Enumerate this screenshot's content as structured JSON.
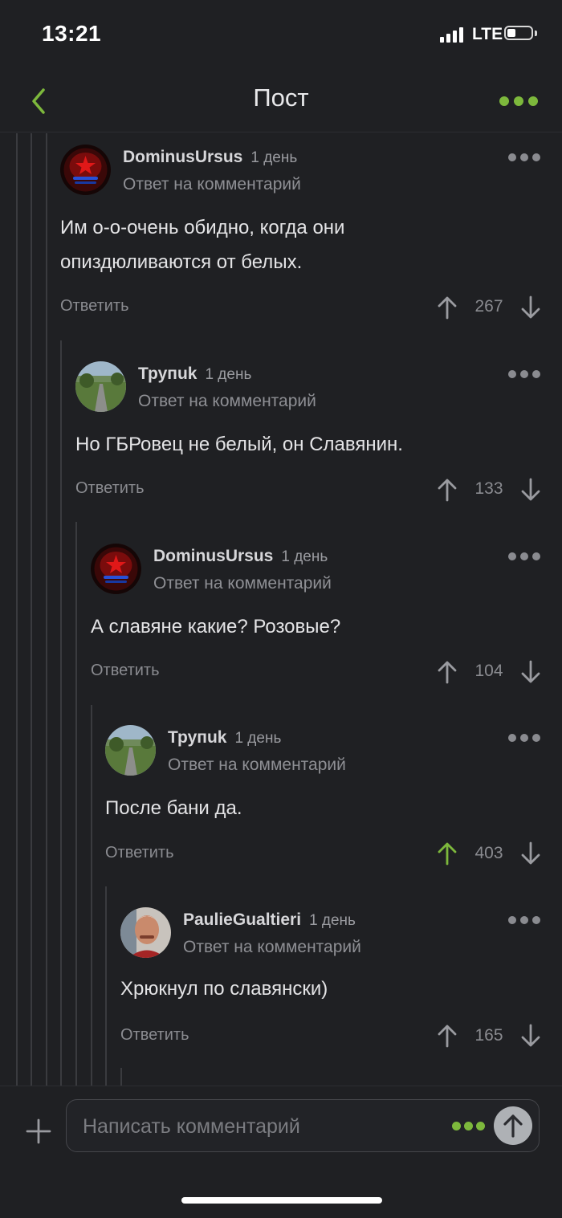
{
  "status_bar": {
    "time": "13:21",
    "network": "LTE"
  },
  "nav": {
    "title": "Пост",
    "back_icon": "chevron-left-icon",
    "more_icon": "more-dots-icon"
  },
  "colors": {
    "accent": "#7db83c",
    "background": "#1f2023",
    "muted": "#8a8b90"
  },
  "comments": [
    {
      "author": "DominusUrsus",
      "time": "1 день",
      "subtitle": "Ответ на комментарий",
      "text_lines": [
        "Им о-о-очень обидно, когда они",
        "опиздюливаются от белых."
      ],
      "reply_label": "Ответить",
      "score": "267",
      "upvoted": false,
      "avatar": "red-mask-avatar"
    },
    {
      "author": "Трупuk",
      "time": "1 день",
      "subtitle": "Ответ на комментарий",
      "text_lines": [
        "Но ГБРовец не белый, он Славянин."
      ],
      "reply_label": "Ответить",
      "score": "133",
      "upvoted": false,
      "avatar": "road-landscape-avatar"
    },
    {
      "author": "DominusUrsus",
      "time": "1 день",
      "subtitle": "Ответ на комментарий",
      "text_lines": [
        "А славяне какие? Розовые?"
      ],
      "reply_label": "Ответить",
      "score": "104",
      "upvoted": false,
      "avatar": "red-mask-avatar"
    },
    {
      "author": "Трупuk",
      "time": "1 день",
      "subtitle": "Ответ на комментарий",
      "text_lines": [
        "После бани да."
      ],
      "reply_label": "Ответить",
      "score": "403",
      "upvoted": true,
      "avatar": "road-landscape-avatar"
    },
    {
      "author": "PaulieGualtieri",
      "time": "1 день",
      "subtitle": "Ответ на комментарий",
      "text_lines": [
        "Хрюкнул по славянски)"
      ],
      "reply_label": "Ответить",
      "score": "165",
      "upvoted": false,
      "avatar": "man-portrait-avatar"
    }
  ],
  "composer": {
    "placeholder": "Написать комментарий",
    "send_icon": "arrow-up-icon",
    "add_icon": "plus-icon"
  }
}
